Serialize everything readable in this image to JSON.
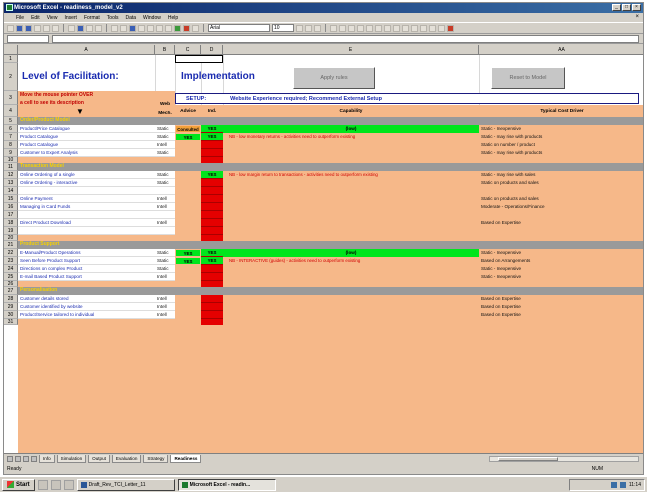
{
  "window": {
    "title": "Microsoft Excel - readiness_model_v2"
  },
  "menu": [
    "File",
    "Edit",
    "View",
    "Insert",
    "Format",
    "Tools",
    "Data",
    "Window",
    "Help"
  ],
  "toolbar": {
    "font_name": "Arial",
    "font_size": "10"
  },
  "formula_bar": {
    "name_box": ""
  },
  "columns": [
    {
      "label": "A",
      "w": 137
    },
    {
      "label": "B",
      "w": 20
    },
    {
      "label": "C",
      "w": 26
    },
    {
      "label": "D",
      "w": 22
    },
    {
      "label": "E",
      "w": 256
    },
    {
      "label": "AA",
      "w": 166
    }
  ],
  "header": {
    "title_left": "Level of Facilitation:",
    "title_right": "Implementation",
    "btn_apply": "Apply rules",
    "btn_reset": "Reset to Model",
    "instruction_1": "Move the mouse pointer OVER",
    "instruction_2": "a cell to see its description",
    "setup_label": "SETUP:",
    "setup_text": "Website Experience required; Recommend External Setup",
    "col_web": "Web",
    "col_web2": "Mech.",
    "col_advice": "Advice",
    "col_ind": "Ind.",
    "col_capability": "Capability",
    "col_typical": "Typical Cost Driver"
  },
  "sections": [
    {
      "title": "Order/Product Model",
      "rows": [
        {
          "label": "Product/Price Catalogue",
          "web": "Static",
          "advice": "Consulted",
          "ind": "YES",
          "cap": "(low)",
          "cap_green": true,
          "driver": "Static - Inexpensive"
        },
        {
          "label": "Product Catalogue",
          "web": "Static",
          "advice": "YES",
          "ind": "YES",
          "cap": "NB - low monetary returns - activities need to outperform existing",
          "cap_green": false,
          "driver": "Static - may rise with products"
        },
        {
          "label": "Product Catalogue",
          "web": "Intell",
          "advice": "",
          "ind": "",
          "cap": "",
          "cap_green": false,
          "driver": "Static on number / product"
        },
        {
          "label": "Customer to Expert Analysis",
          "web": "Static",
          "advice": "",
          "ind": "",
          "cap": "",
          "cap_green": false,
          "driver": "Static - may rise with products"
        }
      ]
    },
    {
      "title": "Transaction Model",
      "rows": [
        {
          "label": "Online Ordering of a single",
          "web": "Static",
          "advice": "",
          "ind": "YES",
          "cap": "NB - low margin return to transactions - activities need to outperform existing",
          "cap_green": false,
          "driver": "Static - may rise with sales"
        },
        {
          "label": "Online Ordering - interactive",
          "web": "Static",
          "advice": "",
          "ind": "",
          "cap": "",
          "cap_green": false,
          "driver": "Static on products and sales"
        },
        {
          "label": "",
          "web": "",
          "advice": "",
          "ind": "",
          "cap": "",
          "cap_green": false,
          "driver": ""
        },
        {
          "label": "Online Payment",
          "web": "Intell",
          "advice": "",
          "ind": "",
          "cap": "",
          "cap_green": false,
          "driver": "Static on products and sales"
        },
        {
          "label": "Managing in Card Funds",
          "web": "Intell",
          "advice": "",
          "ind": "",
          "cap": "",
          "cap_green": false,
          "driver": "Moderate - Operations/Finance"
        },
        {
          "label": "",
          "web": "",
          "advice": "",
          "ind": "",
          "cap": "",
          "cap_green": false,
          "driver": ""
        },
        {
          "label": "Direct Product Download",
          "web": "Intell",
          "advice": "",
          "ind": "",
          "cap": "",
          "cap_green": false,
          "driver": "Based on Expertise"
        },
        {
          "label": "",
          "web": "",
          "advice": "",
          "ind": "",
          "cap": "",
          "cap_green": false,
          "driver": ""
        }
      ]
    },
    {
      "title": "Product Support",
      "rows": [
        {
          "label": "E-Manual/Product Operations",
          "web": "Static",
          "advice": "YES",
          "ind": "YES",
          "cap": "(low)",
          "cap_green": true,
          "driver": "Static - Inexpensive"
        },
        {
          "label": "Seen Before Product Support",
          "web": "Static",
          "advice": "YES",
          "ind": "YES",
          "cap": "NB - INTERACTIVE (guides) - activities need to outperform existing",
          "cap_green": false,
          "driver": "Based on Arrangements"
        },
        {
          "label": "Directions on complex Product",
          "web": "Static",
          "advice": "",
          "ind": "",
          "cap": "",
          "cap_green": false,
          "driver": "Static - Inexpensive"
        },
        {
          "label": "E-mail Based Product Support",
          "web": "Intell",
          "advice": "",
          "ind": "",
          "cap": "",
          "cap_green": false,
          "driver": "Static - Inexpensive"
        }
      ]
    },
    {
      "title": "Personalisation",
      "rows": [
        {
          "label": "Customer details stored",
          "web": "Intell",
          "advice": "",
          "ind": "",
          "cap": "",
          "cap_green": false,
          "driver": "Based on Expertise"
        },
        {
          "label": "Customer identified by website",
          "web": "Intell",
          "advice": "",
          "ind": "",
          "cap": "",
          "cap_green": false,
          "driver": "Based on Expertise"
        },
        {
          "label": "Product/Service tailored to individual",
          "web": "Intell",
          "advice": "",
          "ind": "",
          "cap": "",
          "cap_green": false,
          "driver": "Based on Expertise"
        }
      ]
    }
  ],
  "sheet_tabs": [
    "Info",
    "Simulation",
    "Output",
    "Evaluation",
    "Strategy",
    "Readiness"
  ],
  "active_tab": "Readiness",
  "status": {
    "left": "Ready",
    "right": "NUM"
  },
  "taskbar": {
    "start": "Start",
    "tasks": [
      "Draft_Rev_TCI_Letter_11",
      "Microsoft Excel - readin..."
    ],
    "clock": "11:14"
  }
}
